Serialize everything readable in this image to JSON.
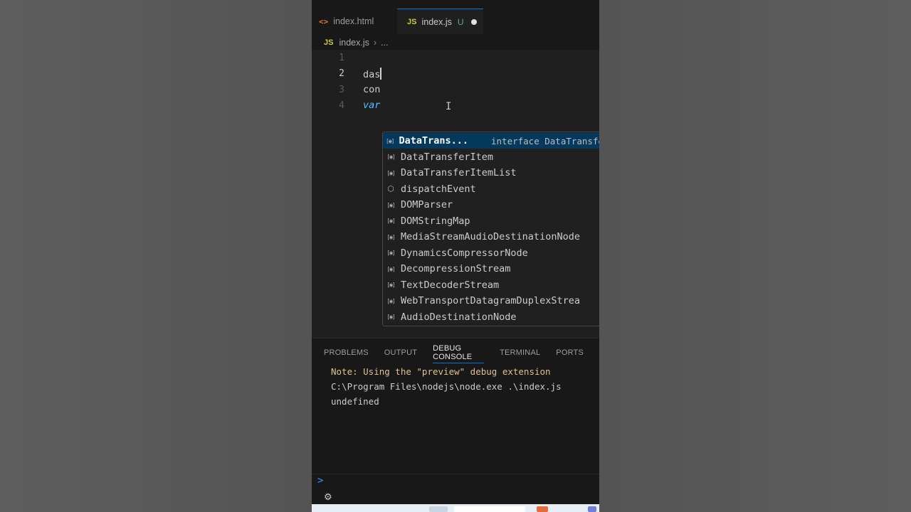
{
  "tabs": [
    {
      "icon": "html-icon",
      "label": "index.html"
    },
    {
      "icon": "js-icon",
      "label": "index.js",
      "status": "U"
    }
  ],
  "js_glyph": "JS",
  "html_glyph": "<>",
  "breadcrumb": {
    "file": "index.js",
    "more": "..."
  },
  "editor": {
    "line_numbers": [
      "1",
      "2",
      "3",
      "4"
    ],
    "line2": "das",
    "line3": "con",
    "line4": "var"
  },
  "suggest": {
    "items": [
      {
        "label": "DataTrans...",
        "detail": "interface DataTransfe",
        "kind": "variable"
      },
      {
        "label": "DataTransferItem",
        "kind": "variable"
      },
      {
        "label": "DataTransferItemList",
        "kind": "variable"
      },
      {
        "label": "dispatchEvent",
        "kind": "method"
      },
      {
        "label": "DOMParser",
        "kind": "variable"
      },
      {
        "label": "DOMStringMap",
        "kind": "variable"
      },
      {
        "label": "MediaStreamAudioDestinationNode",
        "kind": "variable"
      },
      {
        "label": "DynamicsCompressorNode",
        "kind": "variable"
      },
      {
        "label": "DecompressionStream",
        "kind": "variable"
      },
      {
        "label": "TextDecoderStream",
        "kind": "variable"
      },
      {
        "label": "WebTransportDatagramDuplexStrea",
        "kind": "variable"
      },
      {
        "label": "AudioDestinationNode",
        "kind": "variable"
      }
    ]
  },
  "panel": {
    "tabs": [
      "PROBLEMS",
      "OUTPUT",
      "DEBUG CONSOLE",
      "TERMINAL",
      "PORTS"
    ],
    "active_tab": "DEBUG CONSOLE",
    "console": [
      "Note: Using the \"preview\" debug extension",
      "C:\\Program Files\\nodejs\\node.exe .\\index.js",
      "undefined"
    ],
    "prompt": ">"
  },
  "colors": {
    "accent": "#0078d4",
    "note": "#e2c08d",
    "js_icon": "#cbcb41",
    "html_icon": "#e37933",
    "untracked": "#73c991"
  }
}
